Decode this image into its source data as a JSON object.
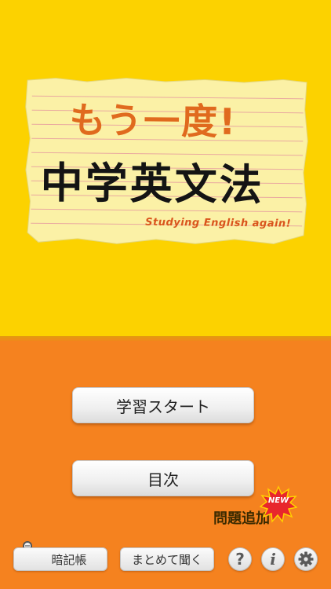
{
  "header": {
    "title_line1": "もう一度!",
    "title_line2": "中学英文法",
    "subtitle": "Studying English again!"
  },
  "menu": {
    "start_label": "学習スタート",
    "toc_label": "目次",
    "new_badge": "NEW",
    "added_label": "問題追加"
  },
  "toolbar": {
    "notebook_label": "暗記帳",
    "listen_label": "まとめて聞く",
    "help_label": "?",
    "info_label": "i"
  },
  "colors": {
    "top_background": "#fcd200",
    "bottom_background": "#f5821f",
    "title_orange": "#e06a1e",
    "badge_red": "#e8262c"
  }
}
